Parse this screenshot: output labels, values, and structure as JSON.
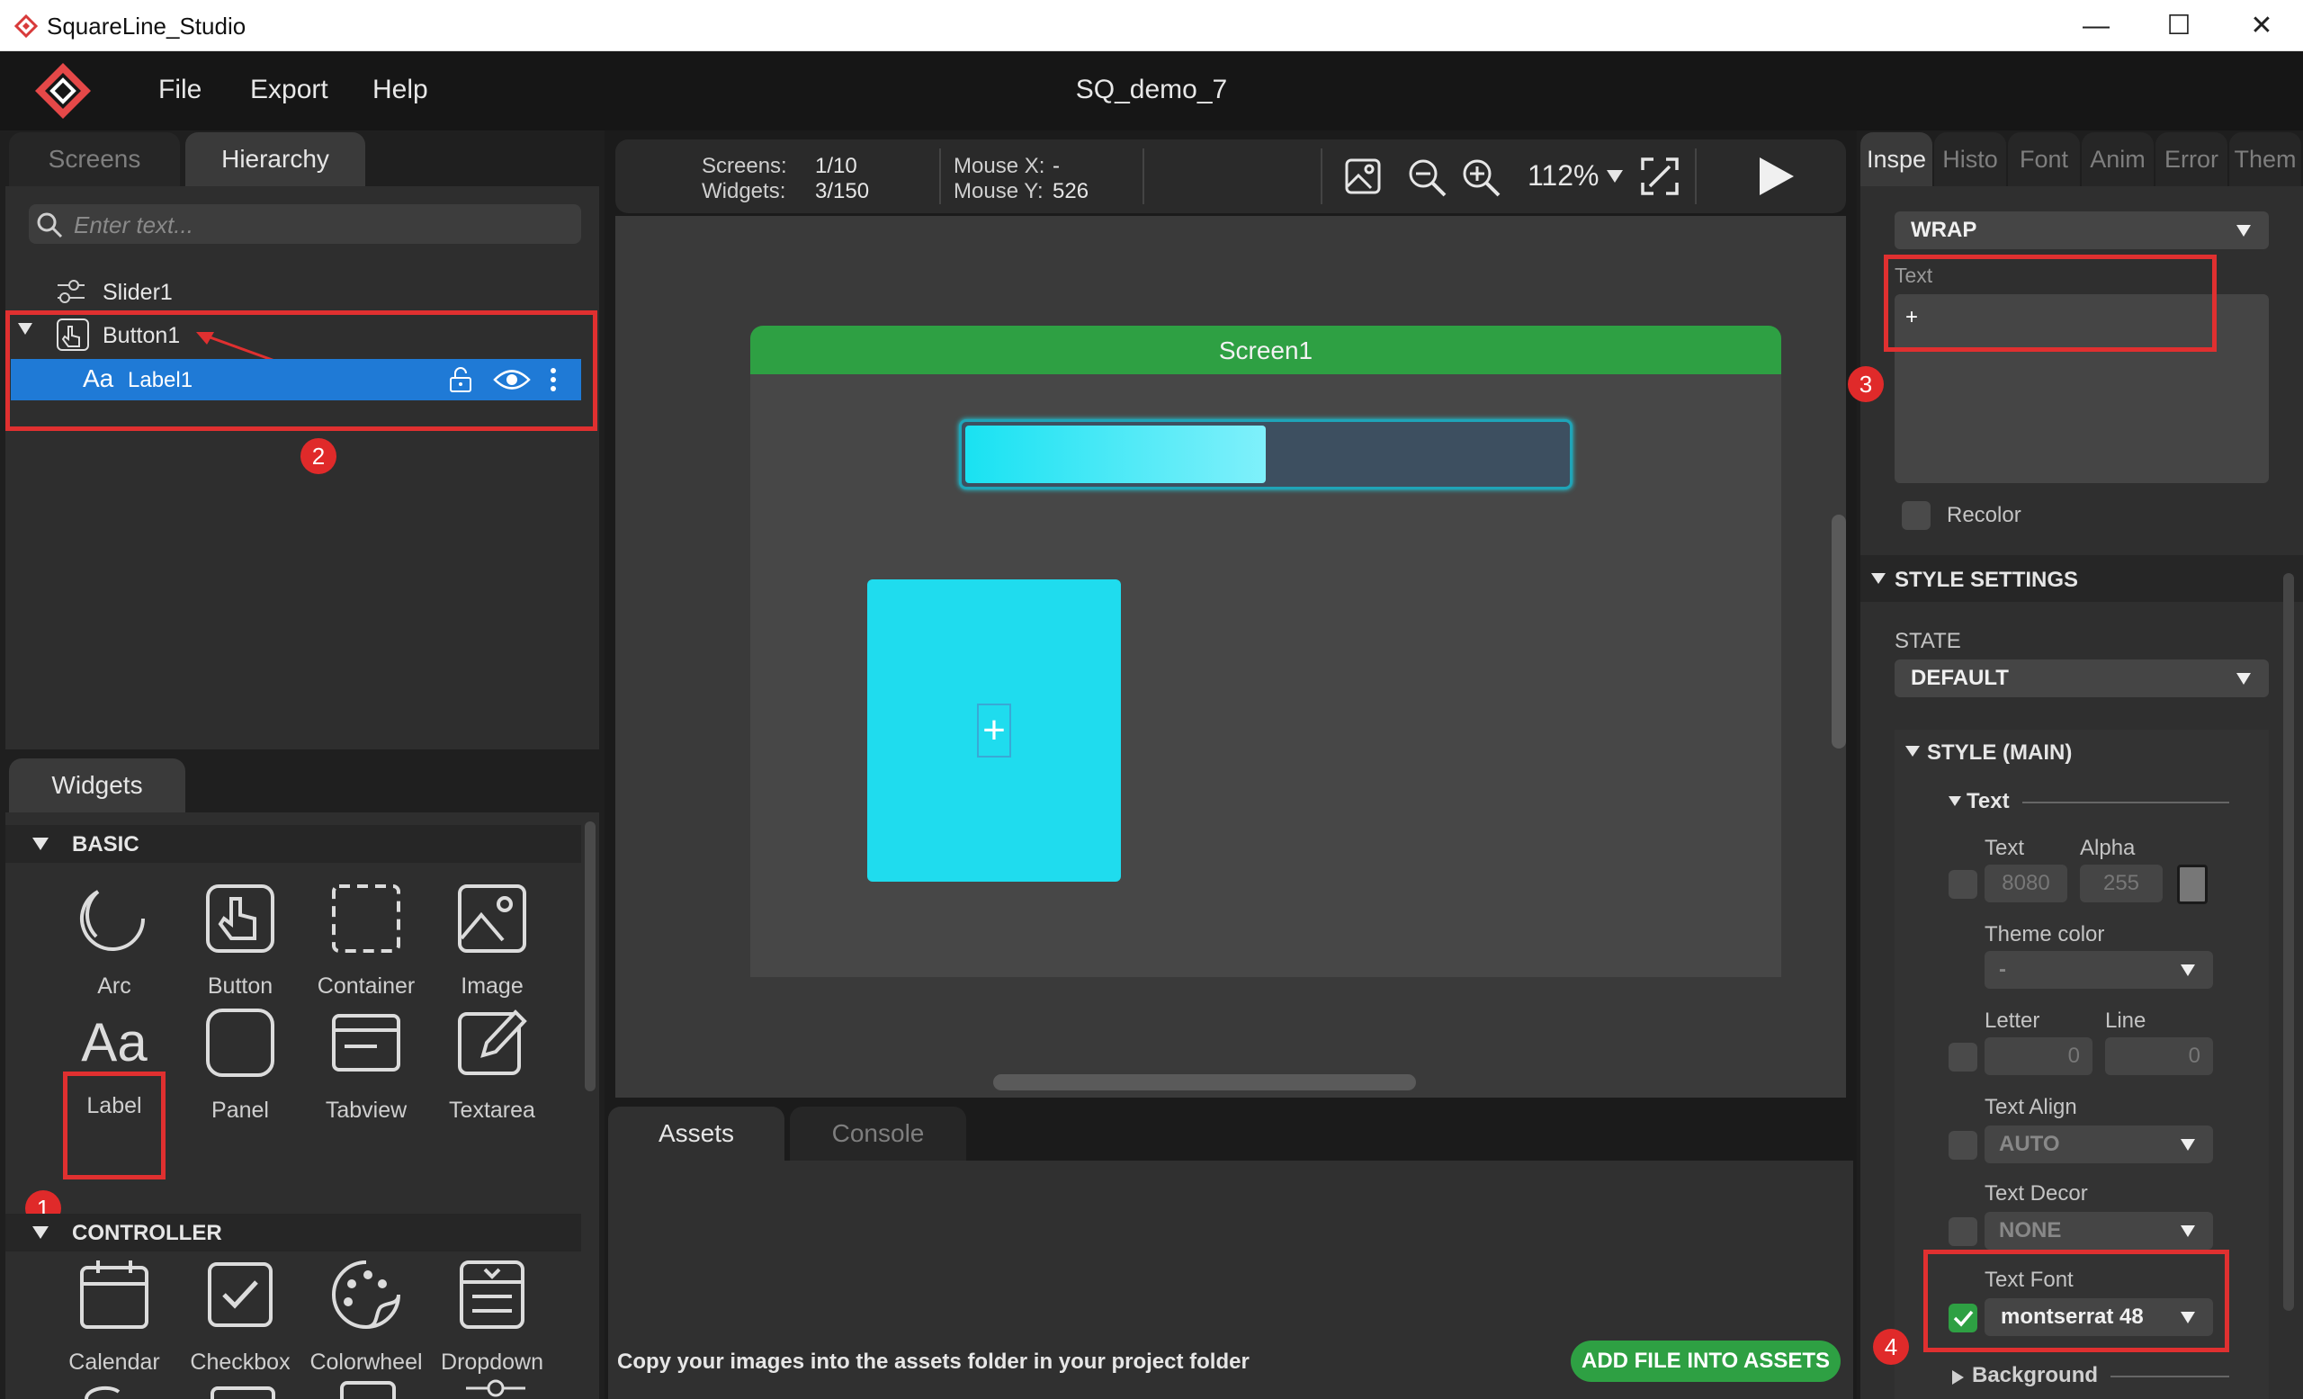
{
  "window": {
    "title": "SquareLine_Studio",
    "minimize": "—",
    "maximize": "☐",
    "close": "✕"
  },
  "menu": {
    "file": "File",
    "export": "Export",
    "help": "Help",
    "project_title": "SQ_demo_7"
  },
  "left_tabs": {
    "screens": "Screens",
    "hierarchy": "Hierarchy"
  },
  "search": {
    "placeholder": "Enter text..."
  },
  "hierarchy": {
    "slider": "Slider1",
    "button": "Button1",
    "label": "Label1"
  },
  "badges": {
    "b1": "1",
    "b2": "2",
    "b3": "3",
    "b4": "4"
  },
  "widgets": {
    "tab": "Widgets",
    "basic_header": "BASIC",
    "controller_header": "CONTROLLER",
    "basic": [
      "Arc",
      "Button",
      "Container",
      "Image",
      "Label",
      "Panel",
      "Tabview",
      "Textarea"
    ],
    "controller": [
      "Calendar",
      "Checkbox",
      "Colorwheel",
      "Dropdown"
    ]
  },
  "toolbar": {
    "screens_label": "Screens:",
    "screens_value": "1/10",
    "widgets_label": "Widgets:",
    "widgets_value": "3/150",
    "mouse_x_label": "Mouse X:",
    "mouse_x_value": "-",
    "mouse_y_label": "Mouse Y:",
    "mouse_y_value": "526",
    "zoom": "112%"
  },
  "canvas": {
    "screen_name": "Screen1",
    "slider_value_fraction": 0.5,
    "button_text": "+"
  },
  "bottom": {
    "assets_tab": "Assets",
    "console_tab": "Console",
    "hint": "Copy your images into the assets folder in your project folder",
    "add_button": "ADD FILE INTO ASSETS"
  },
  "right_tabs": [
    "Inspe",
    "Histo",
    "Font",
    "Anim",
    "Error",
    "Them"
  ],
  "inspector": {
    "wrap_value": "WRAP",
    "text_label": "Text",
    "text_value": "+",
    "recolor": "Recolor",
    "style_settings": "STYLE SETTINGS",
    "state_label": "STATE",
    "state_value": "DEFAULT",
    "style_main": "STYLE (MAIN)",
    "text_section": "Text",
    "text_color_label": "Text",
    "alpha_label": "Alpha",
    "text_color_value": "8080",
    "alpha_value": "255",
    "theme_color_label": "Theme color",
    "theme_color_value": "-",
    "letter_label": "Letter",
    "line_label": "Line",
    "letter_value": "0",
    "line_value": "0",
    "text_align_label": "Text Align",
    "text_align_value": "AUTO",
    "text_decor_label": "Text Decor",
    "text_decor_value": "NONE",
    "text_font_label": "Text Font",
    "text_font_value": "montserrat 48",
    "background_label": "Background"
  },
  "colors": {
    "accent_green": "#2ea043",
    "highlight_red": "#e03030",
    "cyan": "#1fdcee",
    "selection_blue": "#1f7ad6"
  }
}
